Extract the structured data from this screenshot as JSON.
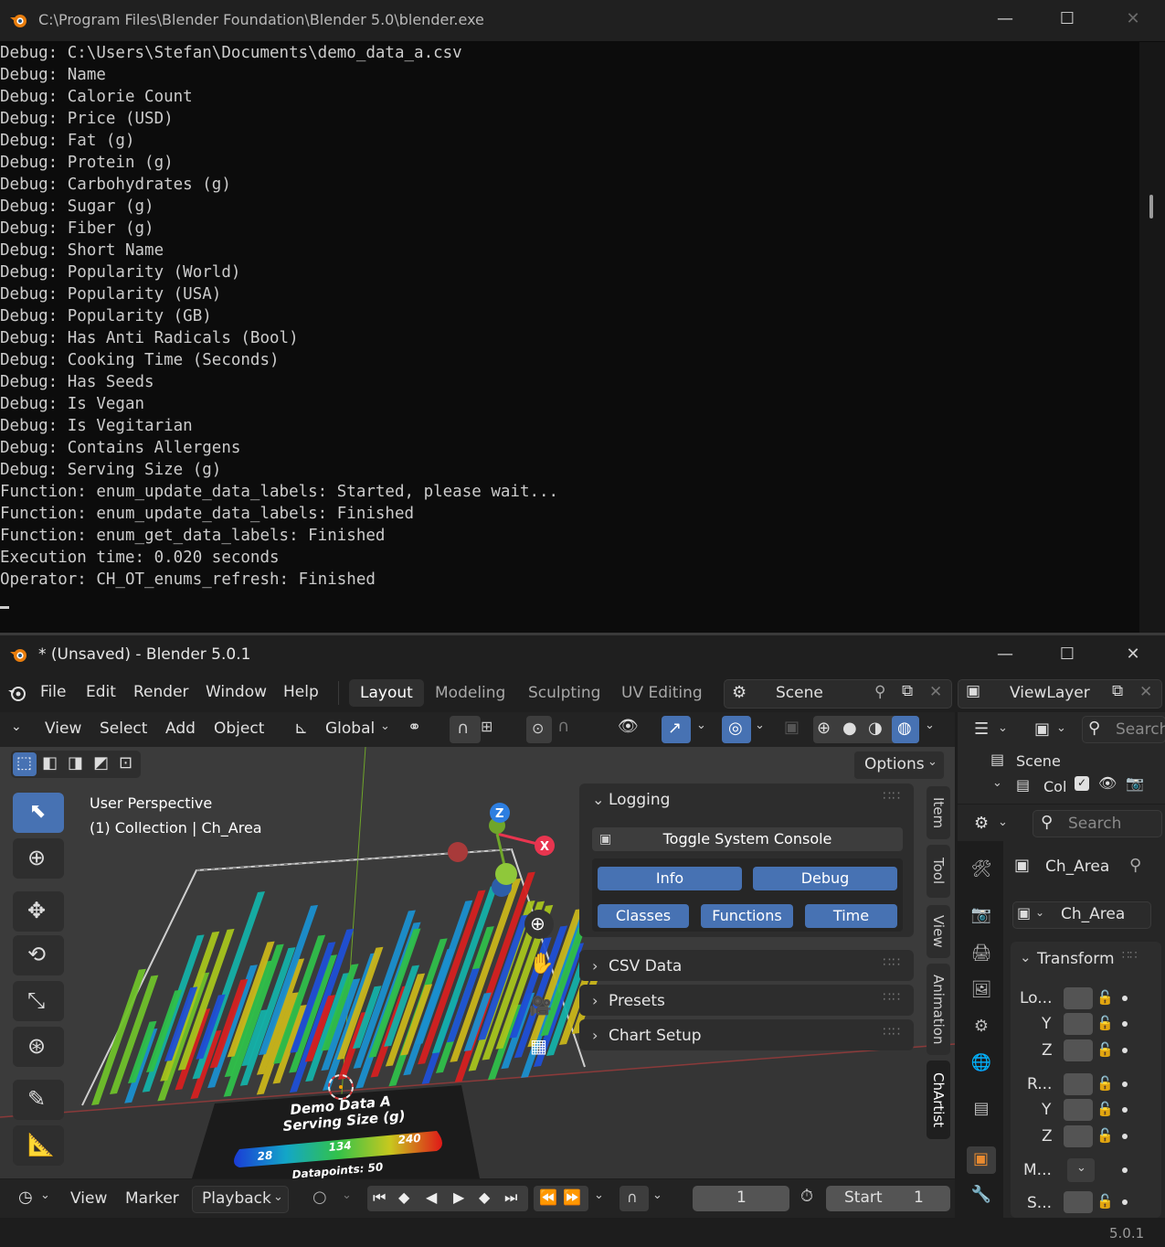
{
  "console": {
    "title": "C:\\Program Files\\Blender Foundation\\Blender 5.0\\blender.exe",
    "lines": [
      "Debug: C:\\Users\\Stefan\\Documents\\demo_data_a.csv",
      "Debug: Name",
      "Debug: Calorie Count",
      "Debug: Price (USD)",
      "Debug: Fat (g)",
      "Debug: Protein (g)",
      "Debug: Carbohydrates (g)",
      "Debug: Sugar (g)",
      "Debug: Fiber (g)",
      "Debug: Short Name",
      "Debug: Popularity (World)",
      "Debug: Popularity (USA)",
      "Debug: Popularity (GB)",
      "Debug: Has Anti Radicals (Bool)",
      "Debug: Cooking Time (Seconds)",
      "Debug: Has Seeds",
      "Debug: Is Vegan",
      "Debug: Is Vegitarian",
      "Debug: Contains Allergens",
      "Debug: Serving Size (g)",
      "Function: enum_update_data_labels: Started, please wait...",
      "Function: enum_update_data_labels: Finished",
      "Function: enum_get_data_labels: Finished",
      "Execution time: 0.020 seconds",
      "Operator: CH_OT_enums_refresh: Finished"
    ]
  },
  "window": {
    "title": "* (Unsaved) - Blender 5.0.1",
    "minimize": "—",
    "maximize": "☐",
    "close": "✕"
  },
  "menu": {
    "items": [
      "File",
      "Edit",
      "Render",
      "Window",
      "Help"
    ],
    "workspaces": [
      "Layout",
      "Modeling",
      "Sculpting",
      "UV Editing"
    ],
    "active_workspace": "Layout",
    "scene": "Scene",
    "view_layer": "ViewLayer"
  },
  "viewport_header": {
    "menus": [
      "View",
      "Select",
      "Add",
      "Object"
    ],
    "orientation": "Global",
    "options": "Options"
  },
  "viewport": {
    "perspective": "User Perspective",
    "collection": "(1) Collection | Ch_Area",
    "gizmo_z": "Z",
    "gizmo_x": "X",
    "legend_title": "Demo Data A",
    "legend_subtitle": "Serving Size (g)",
    "legend_min": "28",
    "legend_mid": "134",
    "legend_max": "240",
    "legend_footer": "Datapoints: 50"
  },
  "npanel": {
    "logging": "Logging",
    "toggle_console": "Toggle System Console",
    "buttons_row1": [
      "Info",
      "Debug"
    ],
    "buttons_row2": [
      "Classes",
      "Functions",
      "Time"
    ],
    "csv_data": "CSV Data",
    "presets": "Presets",
    "chart_setup": "Chart Setup",
    "tabs": [
      "Item",
      "Tool",
      "View",
      "Animation",
      "ChArtist"
    ],
    "active_tab": "ChArtist"
  },
  "timeline": {
    "menus": [
      "View",
      "Marker"
    ],
    "playback": "Playback",
    "frame": "1",
    "start_label": "Start",
    "start_value": "1"
  },
  "outliner": {
    "search_placeholder": "Search",
    "scene": "Scene",
    "collection": "Col"
  },
  "properties": {
    "search_placeholder": "Search",
    "object_name": "Ch_Area",
    "data_name": "Ch_Area",
    "transform": "Transform",
    "rows": [
      "Lo...",
      "Y",
      "Z",
      "R...",
      "Y",
      "Z",
      "M...",
      "S..."
    ]
  },
  "status": {
    "version": "5.0.1"
  },
  "colors": {
    "accent": "#4772b3",
    "axis_red": "#e8354f",
    "axis_blue": "#2d7ee0",
    "axis_green": "#6fa52a"
  }
}
